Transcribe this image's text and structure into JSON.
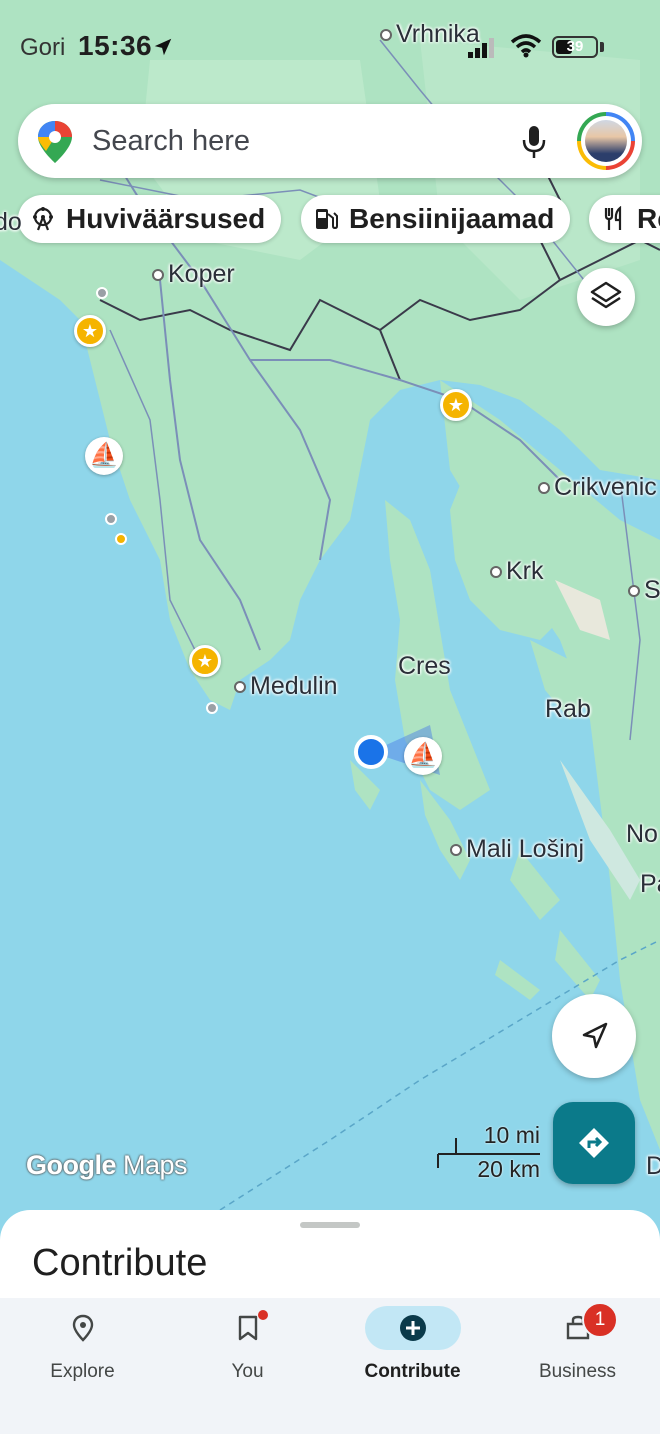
{
  "status_bar": {
    "time": "15:36",
    "left_label": "Gori",
    "battery": "39"
  },
  "search": {
    "placeholder": "Search here"
  },
  "chips": [
    {
      "label": "Huviväärsused",
      "icon": "ferris-wheel-icon"
    },
    {
      "label": "Bensiinijaamad",
      "icon": "gas-pump-icon"
    },
    {
      "label": "Re",
      "icon": "restaurant-icon"
    }
  ],
  "map": {
    "labels": {
      "vrhnika": "Vrhnika",
      "koper": "Koper",
      "crikvenica": "Crikvenic",
      "krk": "Krk",
      "se": "Se",
      "cres": "Cres",
      "rab": "Rab",
      "medulin": "Medulin",
      "mali_losinj": "Mali Lošinj",
      "no": "No",
      "pa": "Pa",
      "d": "D",
      "left_edge": "do"
    },
    "scale": {
      "imperial": "10 mi",
      "metric": "20 km"
    },
    "logo": {
      "google": "Google",
      "maps": "Maps"
    },
    "colors": {
      "water": "#8fd6ea",
      "land": "#aee3c2",
      "accent": "#0b7a8a",
      "location": "#1a73e8"
    }
  },
  "sheet": {
    "title": "Contribute"
  },
  "bottom_nav": [
    {
      "label": "Explore",
      "icon": "location-pin-icon"
    },
    {
      "label": "You",
      "icon": "bookmark-icon",
      "has_dot": true
    },
    {
      "label": "Contribute",
      "icon": "add-circle-icon",
      "active": true
    },
    {
      "label": "Business",
      "icon": "store-icon",
      "badge": "1"
    }
  ]
}
